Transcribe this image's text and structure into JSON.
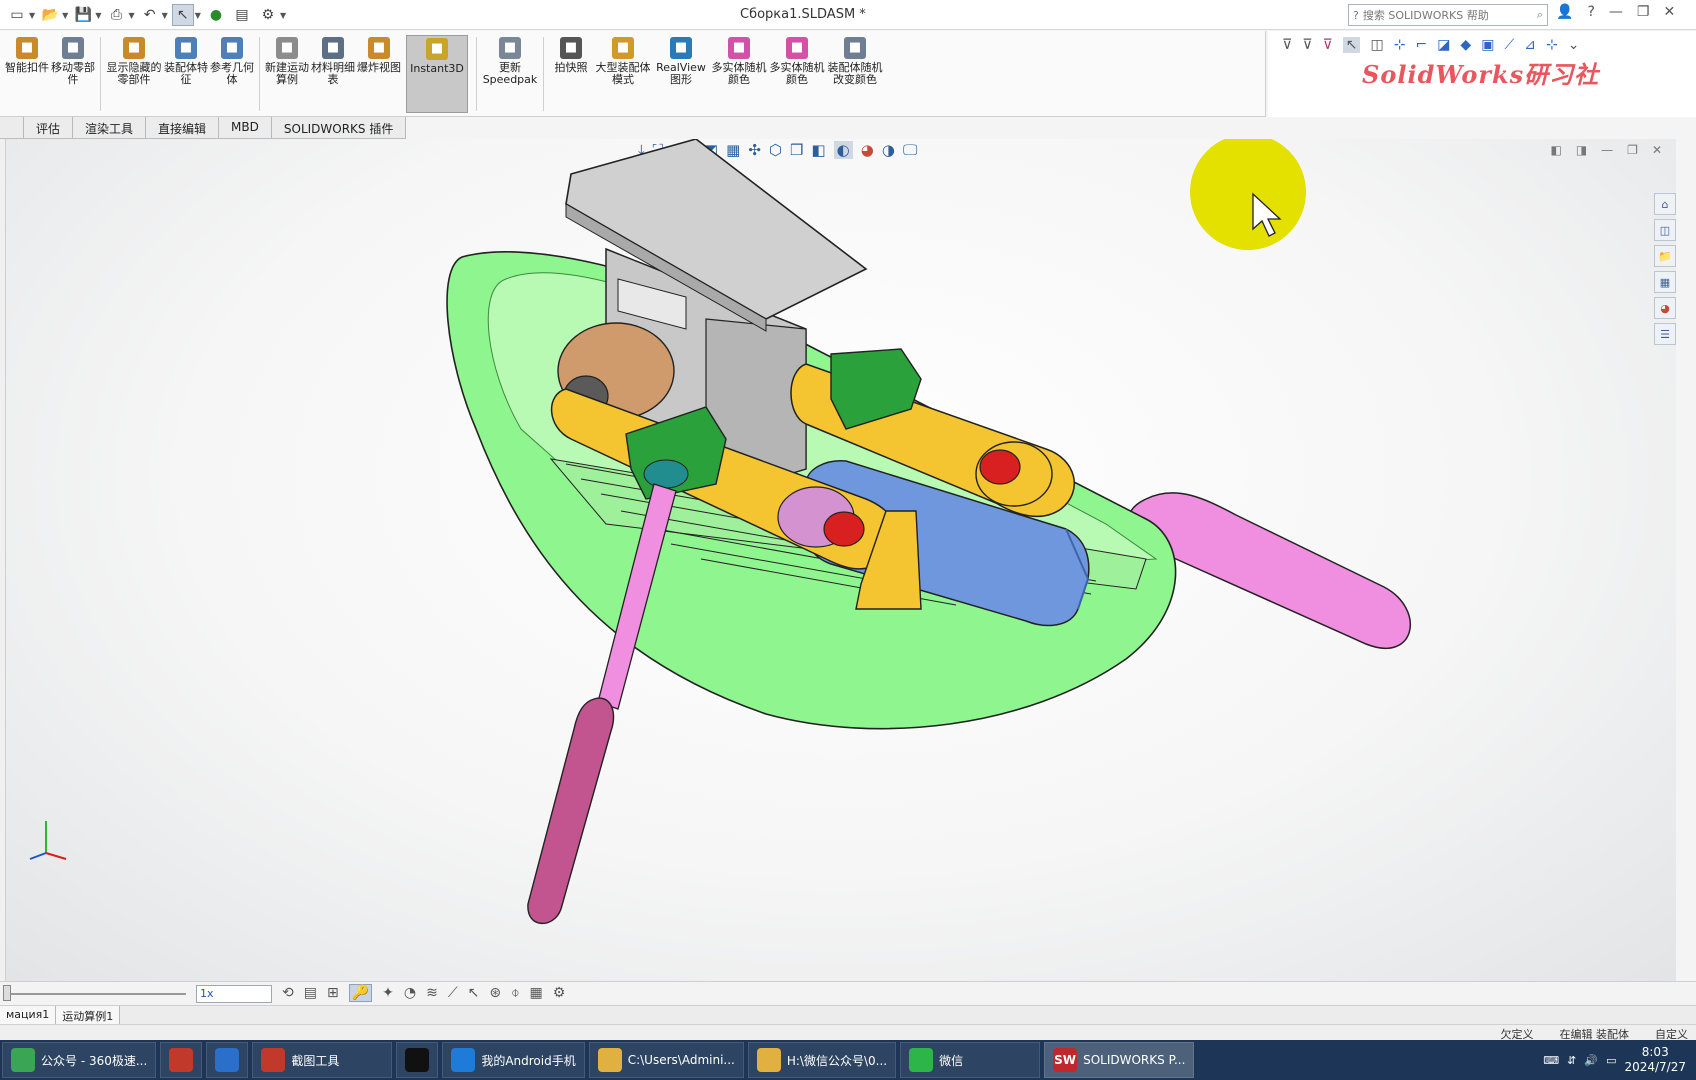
{
  "titlebar": {
    "document_title": "Сборка1.SLDASM *",
    "search_placeholder": "搜索 SOLIDWORKS 帮助"
  },
  "ribbon": {
    "buttons": [
      {
        "label": "智能扣件",
        "icon": "fastener-icon",
        "color": "#c98a2a"
      },
      {
        "label": "移动零部件",
        "icon": "move-component-icon",
        "color": "#6f7f93"
      },
      {
        "label": "显示隐藏的零部件",
        "icon": "show-hidden-icon",
        "color": "#c98a2a"
      },
      {
        "label": "装配体特征",
        "icon": "assembly-feature-icon",
        "color": "#4f7fb7"
      },
      {
        "label": "参考几何体",
        "icon": "reference-geometry-icon",
        "color": "#4f7fb7"
      },
      {
        "label": "新建运动算例",
        "icon": "motion-study-icon",
        "color": "#8c8c8c"
      },
      {
        "label": "材料明细表",
        "icon": "bom-icon",
        "color": "#5c6f85"
      },
      {
        "label": "爆炸视图",
        "icon": "exploded-view-icon",
        "color": "#c98a2a"
      },
      {
        "label": "Instant3D",
        "icon": "instant3d-icon",
        "color": "#c9a42a"
      },
      {
        "label": "更新Speedpak",
        "icon": "speedpak-icon",
        "color": "#7a8797"
      },
      {
        "label": "拍快照",
        "icon": "camera-icon",
        "color": "#555555"
      },
      {
        "label": "大型装配体模式",
        "icon": "large-assembly-icon",
        "color": "#d09a2a"
      },
      {
        "label": "RealView图形",
        "icon": "realview-icon",
        "color": "#2a7ab8"
      },
      {
        "label": "多实体随机颜色",
        "icon": "random-color-icon",
        "color": "#d451a8"
      },
      {
        "label": "多实体随机颜色",
        "icon": "random-color-icon",
        "color": "#d451a8"
      },
      {
        "label": "装配体随机改变颜色",
        "icon": "assembly-color-icon",
        "color": "#6f7f93"
      }
    ]
  },
  "watermark": "SolidWorks研习社",
  "tabs": [
    "评估",
    "渲染工具",
    "直接编辑",
    "MBD",
    "SOLIDWORKS 插件"
  ],
  "motion": {
    "speed_value": "1x"
  },
  "study_tabs": [
    "мация1",
    "运动算例1"
  ],
  "status": {
    "state": "欠定义",
    "mode": "在编辑 装配体",
    "custom": "自定义"
  },
  "taskbar": {
    "items": [
      {
        "label": "公众号 - 360极速...",
        "icon": "browser-360-icon",
        "color": "#3aa655"
      },
      {
        "label": "",
        "icon": "app-icon",
        "color": "#c0392b"
      },
      {
        "label": "",
        "icon": "windows-icon",
        "color": "#2a6fc9"
      },
      {
        "label": "截图工具",
        "icon": "snipping-tool-icon",
        "color": "#c0392b"
      },
      {
        "label": "",
        "icon": "record-icon",
        "color": "#111111"
      },
      {
        "label": "我的Android手机",
        "icon": "phone-icon",
        "color": "#1e7bd8"
      },
      {
        "label": "C:\\Users\\Admini...",
        "icon": "folder-icon",
        "color": "#e0b040"
      },
      {
        "label": "H:\\微信公众号\\0...",
        "icon": "folder-icon",
        "color": "#e0b040"
      },
      {
        "label": "微信",
        "icon": "wechat-icon",
        "color": "#2db54a"
      },
      {
        "label": "SOLIDWORKS P...",
        "icon": "solidworks-icon",
        "color": "#c0282d"
      }
    ],
    "clock_time": "8:03",
    "clock_date": "2024/7/27"
  },
  "colors": {
    "hull": "#8ff58f",
    "cabin": "#c8c8c8",
    "link": "#f4c431",
    "bracket": "#2aa13a",
    "oar": "#f08ee0",
    "motor": "#6e97de",
    "cursor_highlight": "#e4e000"
  }
}
